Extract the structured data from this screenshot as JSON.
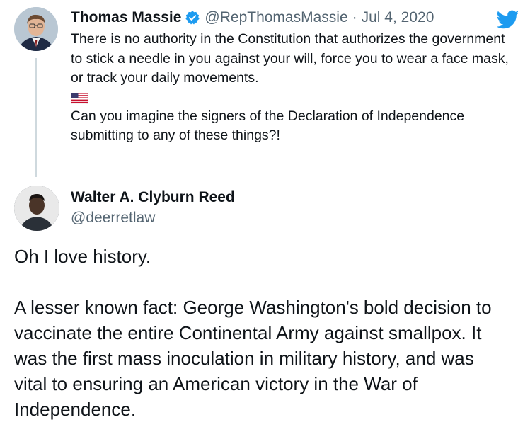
{
  "quoted_tweet": {
    "author_name": "Thomas Massie",
    "handle": "@RepThomasMassie",
    "separator": "·",
    "date": "Jul 4, 2020",
    "text_1": "There is no authority in the Constitution that authorizes the government to stick a needle in you against your will, force you to wear a face mask, or track your daily movements.",
    "text_2": "Can you imagine the signers of the Declaration of Independence submitting to any of these things?!",
    "verified_icon": "verified-badge-icon",
    "flag_icon": "us-flag-icon",
    "brand_icon": "twitter-bird-icon"
  },
  "reply": {
    "author_name": "Walter A. Clyburn Reed",
    "handle": "@deerretlaw",
    "text_1": "Oh I love history.",
    "text_2": "A lesser known fact: George Washington's bold decision to vaccinate the entire Continental Army against smallpox. It was the first mass inoculation in military history, and was vital to ensuring an American victory in the War of Independence."
  },
  "colors": {
    "brand_blue": "#1d9bf0",
    "text_primary": "#0f1419",
    "text_muted": "#536471",
    "thread_line": "#cfd9de"
  }
}
